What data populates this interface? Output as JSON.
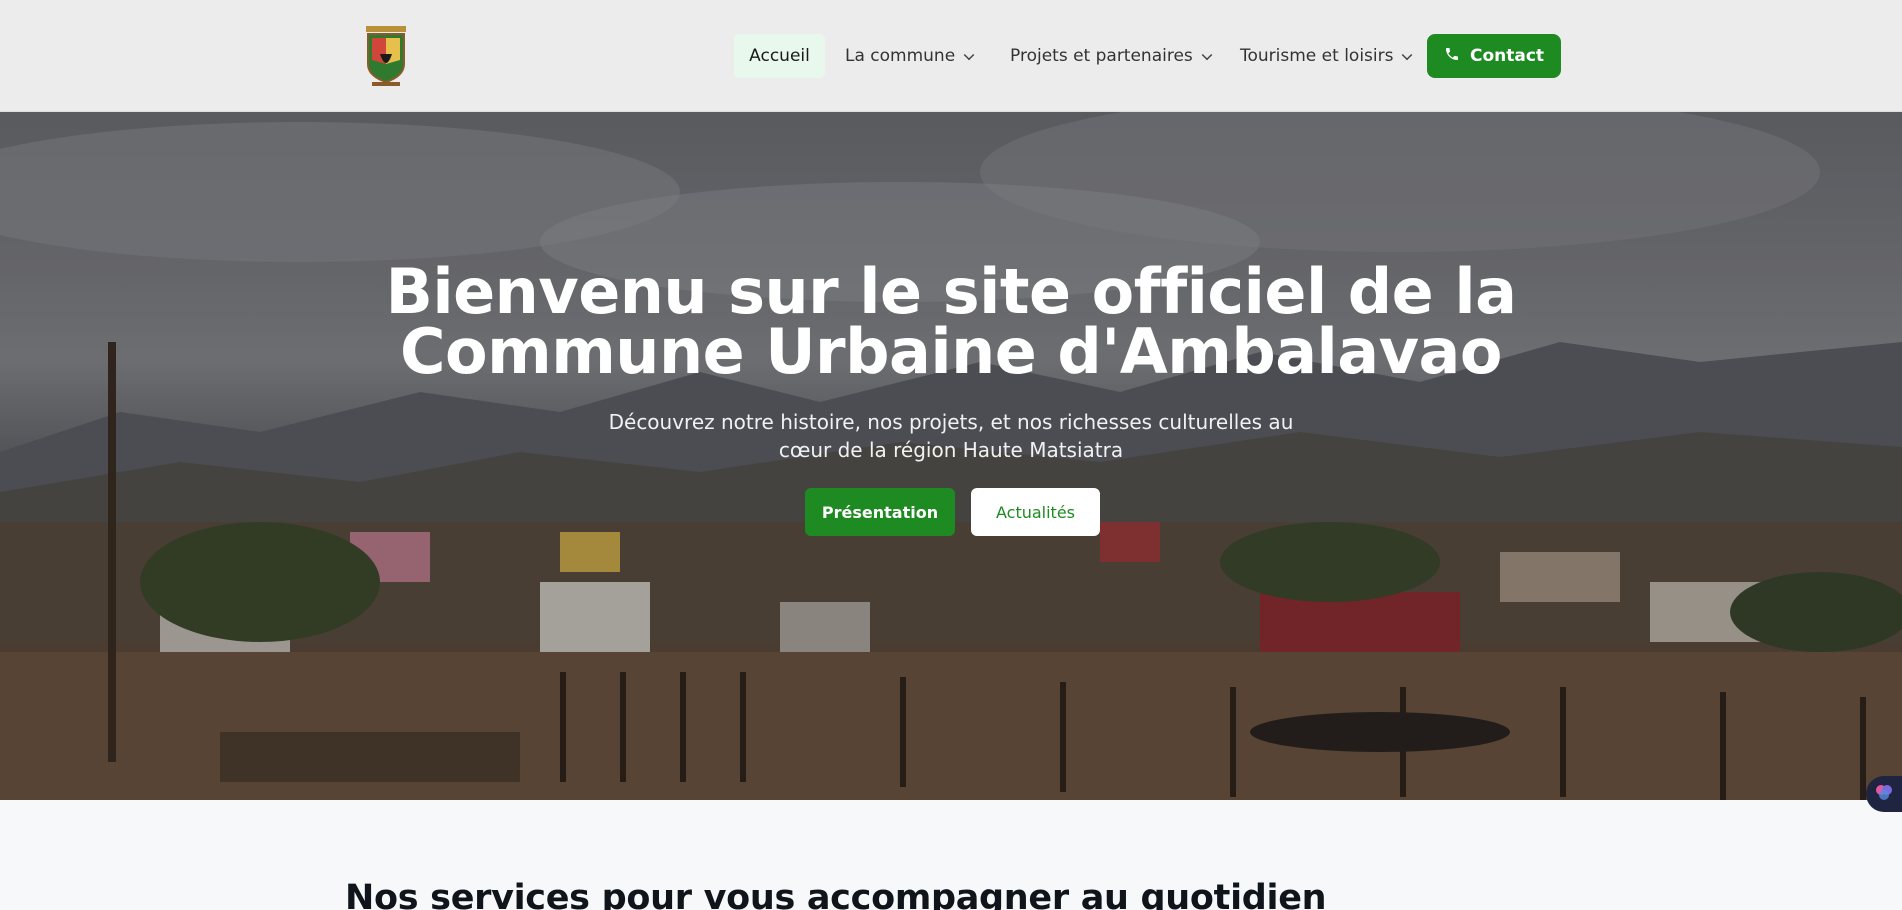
{
  "header": {
    "logo_icon": "commune-crest-logo",
    "nav": {
      "home": "Accueil",
      "commune": "La commune",
      "projets": "Projets et partenaires",
      "tourisme": "Tourisme et loisirs"
    },
    "contact_label": "Contact",
    "contact_icon": "phone-icon"
  },
  "hero": {
    "title_line1": "Bienvenu sur le site officiel de la",
    "title_line2": "Commune Urbaine d'Ambalavao",
    "subtitle": "Découvrez notre histoire, nos projets, et nos richesses culturelles au cœur de la région Haute Matsiatra",
    "btn_presentation": "Présentation",
    "btn_actualites": "Actualités"
  },
  "floating_widget_icon": "brain-icon",
  "services": {
    "title": "Nos services pour vous accompagner au quotidien"
  },
  "colors": {
    "accent": "#1d8a22",
    "nav_active_bg": "#e9f8ec",
    "header_bg": "#ececec"
  }
}
